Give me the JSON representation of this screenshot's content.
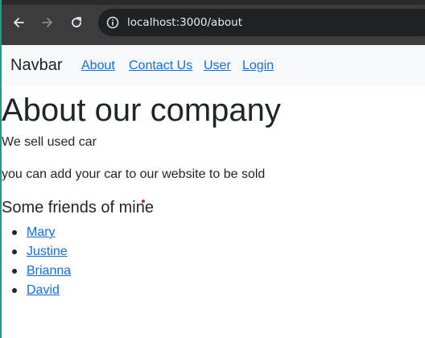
{
  "browser": {
    "url": "localhost:3000/about",
    "icons": {
      "back": "arrow-left-icon",
      "forward": "arrow-right-icon",
      "reload": "reload-icon",
      "site_info": "site-info-icon"
    }
  },
  "navbar": {
    "brand": "Navbar",
    "links": [
      "About",
      "Contact Us",
      "User",
      "Login"
    ]
  },
  "page": {
    "title": "About our company",
    "paragraphs": [
      "We sell used car",
      "you can add your car to our website to be sold"
    ],
    "friends_heading": "Some friends of mine",
    "friends": [
      "Mary",
      "Justine",
      "Brianna",
      "David"
    ]
  },
  "colors": {
    "link": "#0d6efd",
    "text": "#212529",
    "navbar_bg": "#f8f9fa",
    "browser_chrome": "#3c3c3c"
  }
}
